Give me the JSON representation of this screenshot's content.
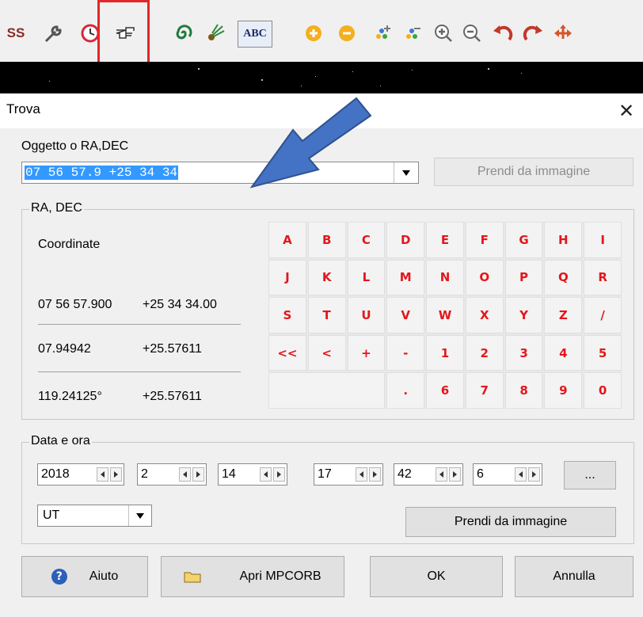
{
  "toolbar": {
    "partial_label": "SS",
    "abc_label": "ABC",
    "icons": [
      "tools-icon",
      "clock-icon",
      "hand-pointer-icon",
      "galaxy-icon",
      "comet-icon",
      "abc-icon",
      "zoom-plus-icon",
      "zoom-minus-icon",
      "add-grid-icon",
      "remove-grid-icon",
      "magnify-plus-icon",
      "magnify-minus-icon",
      "undo-icon",
      "redo-icon",
      "move-arrows-icon"
    ]
  },
  "dialog": {
    "title": "Trova",
    "close_glyph": "✕",
    "object_label": "Oggetto o RA,DEC",
    "object_value": "07 56 57.9 +25 34 34",
    "get_from_image_top": "Prendi da immagine",
    "radec_group": "RA, DEC",
    "coordinate_label": "Coordinate",
    "coords": [
      {
        "ra": "07 56 57.900",
        "dec": "+25 34 34.00"
      },
      {
        "ra": "07.94942",
        "dec": "+25.57611"
      },
      {
        "ra": "119.24125°",
        "dec": "+25.57611"
      }
    ],
    "keypad": [
      [
        "A",
        "B",
        "C",
        "D",
        "E",
        "F",
        "G",
        "H",
        "I"
      ],
      [
        "J",
        "K",
        "L",
        "M",
        "N",
        "O",
        "P",
        "Q",
        "R"
      ],
      [
        "S",
        "T",
        "U",
        "V",
        "W",
        "X",
        "Y",
        "Z",
        "/"
      ],
      [
        "<<",
        "<",
        "+",
        "-",
        "1",
        "2",
        "3",
        "4",
        "5"
      ],
      [
        "",
        "",
        "",
        ".",
        "6",
        "7",
        "8",
        "9",
        "0"
      ]
    ],
    "datetime_group": "Data e ora",
    "date_fields": [
      "2018",
      "2",
      "14"
    ],
    "time_fields": [
      "17",
      "42",
      "6"
    ],
    "more_button": "...",
    "timezone": "UT",
    "get_from_image_bottom": "Prendi da immagine",
    "buttons": {
      "help": "Aiuto",
      "open_mpcorb": "Apri MPCORB",
      "ok": "OK",
      "cancel": "Annulla"
    }
  },
  "colors": {
    "keypad_text": "#e4161b",
    "highlight_box": "#e32626",
    "arrow_fill": "#4472c4",
    "selection": "#3399ff"
  }
}
